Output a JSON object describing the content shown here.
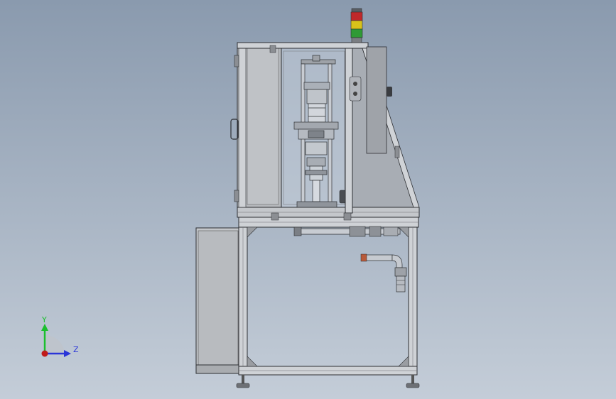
{
  "viewport": {
    "background_top": "#8a9aae",
    "background_bottom": "#c4cdd8"
  },
  "model": {
    "frame_color": "#c9ccd0",
    "panel_color": "#b9bcc0",
    "guard_color": "#d3d6da",
    "cabinet_color": "#9ea2a8",
    "line_color": "#2d2f33"
  },
  "stack_light": {
    "colors": [
      "#c0282a",
      "#d8c21a",
      "#2f9a35"
    ]
  },
  "triad": {
    "y_label": "Y",
    "z_label": "Z",
    "y_color": "#1bbf2e",
    "z_color": "#2a35d8",
    "origin_color": "#c01a1a"
  }
}
